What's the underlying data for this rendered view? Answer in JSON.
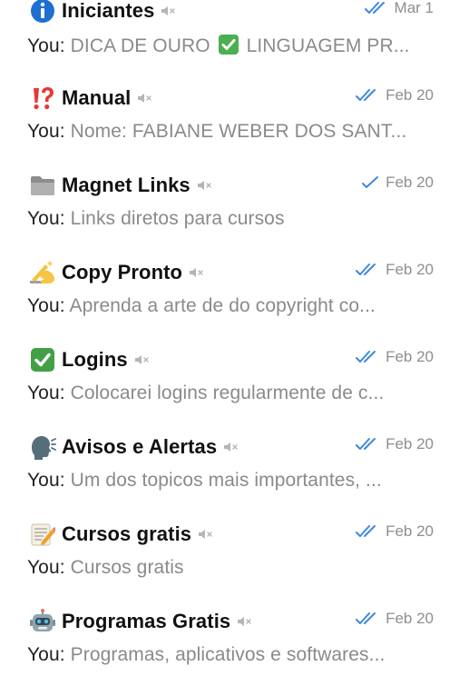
{
  "chats": [
    {
      "icon": "info-emoji",
      "name": "Iniciantes",
      "muted_icon": "muted-speaker-icon",
      "status_icon": "double-check-icon",
      "date": "Mar 1",
      "sender": "You:",
      "preview_before": "DICA DE OURO",
      "preview_emoji": "check-mark-button-emoji",
      "preview_after": "LINGUAGEM PR..."
    },
    {
      "icon": "exclamation-question-emoji",
      "name": "Manual",
      "muted_icon": "muted-speaker-icon",
      "status_icon": "double-check-icon",
      "date": "Feb 20",
      "sender": "You:",
      "preview": "Nome: FABIANE WEBER DOS SANT..."
    },
    {
      "icon": "folder-emoji",
      "name": "Magnet Links",
      "muted_icon": "muted-speaker-icon",
      "status_icon": "single-check-icon",
      "date": "Feb 20",
      "sender": "You:",
      "preview": "Links diretos para cursos"
    },
    {
      "icon": "writing-hand-emoji",
      "name": "Copy Pronto",
      "muted_icon": "muted-speaker-icon",
      "status_icon": "double-check-icon",
      "date": "Feb 20",
      "sender": "You:",
      "preview": "Aprenda a arte de do copyright co..."
    },
    {
      "icon": "check-mark-button-emoji",
      "name": "Logins",
      "muted_icon": "muted-speaker-icon",
      "status_icon": "double-check-icon",
      "date": "Feb 20",
      "sender": "You:",
      "preview": "Colocarei logins regularmente de c..."
    },
    {
      "icon": "speaking-head-emoji",
      "name": "Avisos e Alertas",
      "muted_icon": "muted-speaker-icon",
      "status_icon": "double-check-icon",
      "date": "Feb 20",
      "sender": "You:",
      "preview": "Um dos topicos mais importantes, ..."
    },
    {
      "icon": "memo-emoji",
      "name": "Cursos gratis",
      "muted_icon": "muted-speaker-icon",
      "status_icon": "double-check-icon",
      "date": "Feb 20",
      "sender": "You:",
      "preview": "Cursos gratis"
    },
    {
      "icon": "robot-emoji",
      "name": "Programas Gratis",
      "muted_icon": "muted-speaker-icon",
      "status_icon": "double-check-icon",
      "date": "Feb 20",
      "sender": "You:",
      "preview": "Programas, aplicativos e softwares..."
    }
  ],
  "colors": {
    "check_blue": "#3f88e0",
    "date_gray": "#8e8e93",
    "preview_gray": "#8a8a8a",
    "name_black": "#111111"
  }
}
